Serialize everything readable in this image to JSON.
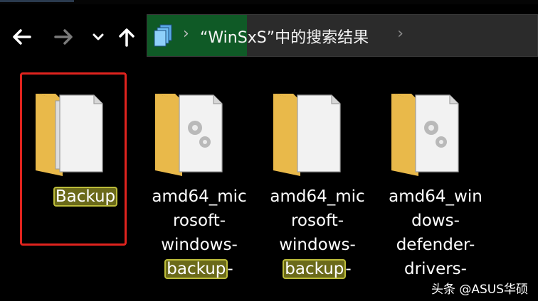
{
  "window": {
    "address_path": "“WinSxS”中的搜索结果",
    "crumb_separator": "›",
    "dropdown_glyph": "›",
    "nav": {
      "back_icon": "arrow-left-icon",
      "forward_icon": "arrow-right-icon",
      "recent_icon": "chevron-down-icon",
      "up_icon": "arrow-up-icon"
    }
  },
  "files": [
    {
      "icon": "folder-with-documents-icon",
      "selected": true,
      "lines": [
        {
          "pre": "",
          "hl": "Backup",
          "post": ""
        }
      ]
    },
    {
      "icon": "folder-with-gear-document-icon",
      "selected": false,
      "lines": [
        {
          "pre": "amd64_mic",
          "hl": "",
          "post": ""
        },
        {
          "pre": "rosoft-",
          "hl": "",
          "post": ""
        },
        {
          "pre": "windows-",
          "hl": "",
          "post": ""
        },
        {
          "pre": "",
          "hl": "backup",
          "post": "-"
        }
      ]
    },
    {
      "icon": "folder-with-document-icon",
      "selected": false,
      "lines": [
        {
          "pre": "amd64_mic",
          "hl": "",
          "post": ""
        },
        {
          "pre": "rosoft-",
          "hl": "",
          "post": ""
        },
        {
          "pre": "windows-",
          "hl": "",
          "post": ""
        },
        {
          "pre": "",
          "hl": "backup",
          "post": "-"
        }
      ]
    },
    {
      "icon": "folder-with-gear-document-icon",
      "selected": false,
      "lines": [
        {
          "pre": "amd64_win",
          "hl": "",
          "post": ""
        },
        {
          "pre": "dows-",
          "hl": "",
          "post": ""
        },
        {
          "pre": "defender-",
          "hl": "",
          "post": ""
        },
        {
          "pre": "drivers-",
          "hl": "",
          "post": ""
        }
      ]
    }
  ],
  "watermark": "头条 @ASUS华硕",
  "colors": {
    "background": "#000000",
    "address_highlight": "#0f5a26",
    "selection_frame": "#e0231e",
    "search_highlight": "#6b6a1a",
    "folder": "#f2cf6a"
  }
}
